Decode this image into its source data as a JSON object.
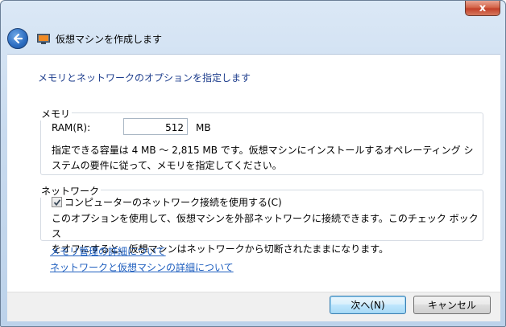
{
  "window": {
    "title": "仮想マシンを作成します",
    "close_label": "x"
  },
  "content": {
    "instruction": "メモリとネットワークのオプションを指定します",
    "memory": {
      "group_label": "メモリ",
      "ram_label": "RAM(R):",
      "ram_value": "512",
      "ram_unit": "MB",
      "description_line1": "指定できる容量は 4 MB ～ 2,815 MB です。仮想マシンにインストールするオペレーティング シ",
      "description_line2": "ステムの要件に従って、メモリを指定してください。"
    },
    "network": {
      "group_label": "ネットワーク",
      "checkbox_label": "コンピューターのネットワーク接続を使用する(C)",
      "checkbox_checked": true,
      "description_line1": "このオプションを使用して、仮想マシンを外部ネットワークに接続できます。このチェック ボックス",
      "description_line2": "をオフにすると、仮想マシンはネットワークから切断されたままになります。"
    },
    "links": {
      "memory_details": "メモリ管理の詳細について",
      "network_details": "ネットワークと仮想マシンの詳細について"
    }
  },
  "footer": {
    "next_label": "次へ(N)",
    "cancel_label": "キャンセル"
  },
  "icons": {
    "back": "back-arrow-icon",
    "app": "virtual-machine-icon",
    "close": "close-icon",
    "check": "checkmark-icon"
  }
}
